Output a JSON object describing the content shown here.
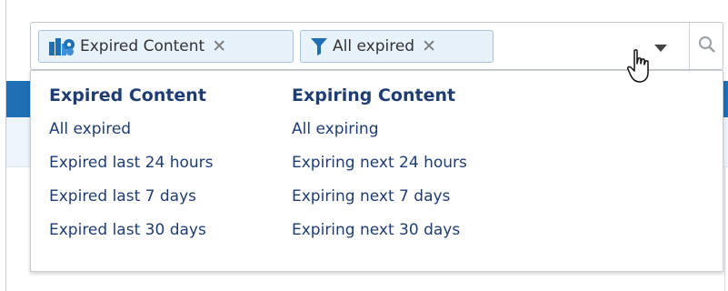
{
  "filters": [
    {
      "label": "Expired Content",
      "icon": "content-types-icon",
      "remove": "✕"
    },
    {
      "label": "All expired",
      "icon": "funnel-icon",
      "remove": "✕"
    }
  ],
  "buttons": {
    "dropdown_icon": "chevron-down-icon",
    "search_icon": "search-icon"
  },
  "dropdown": {
    "expired": {
      "heading": "Expired Content",
      "items": [
        "All expired",
        "Expired last 24 hours",
        "Expired last 7 days",
        "Expired last 30 days"
      ]
    },
    "expiring": {
      "heading": "Expiring Content",
      "items": [
        "All expiring",
        "Expiring next 24 hours",
        "Expiring next 7 days",
        "Expiring next 30 days"
      ]
    }
  },
  "colors": {
    "accent": "#1f6fb4",
    "link": "#1e3d72",
    "chip_bg": "#e8f2fb"
  }
}
